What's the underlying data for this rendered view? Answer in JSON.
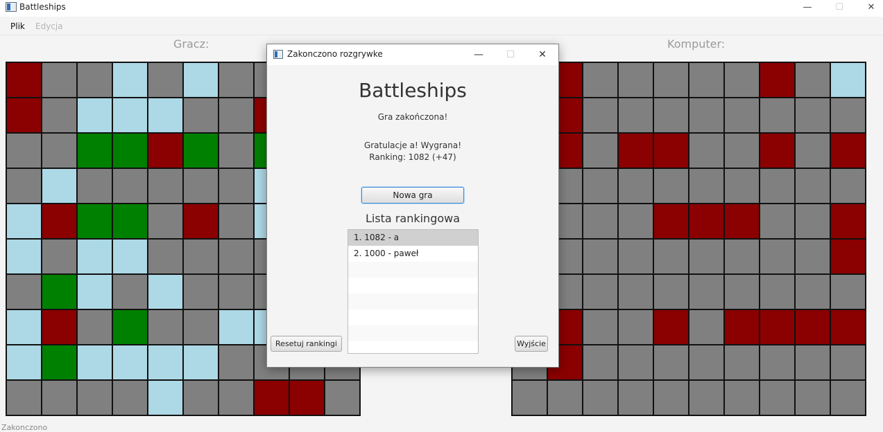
{
  "window": {
    "title": "Battleships",
    "minimize": "—",
    "maximize": "☐",
    "close": "✕"
  },
  "menu": [
    {
      "label": "Plik",
      "disabled": false
    },
    {
      "label": "Edycja",
      "disabled": true
    }
  ],
  "boards": {
    "player": {
      "label": "Gracz:",
      "rows": [
        "HGGWGWGGGG",
        "HGWWWGGHGG",
        "GGSSHSGSGG",
        "GWGGGGGWGG",
        "WHSSGHGWGG",
        "WGWWGGGGGG",
        "GSWGWGGGGG",
        "WHGSGGWWGG",
        "WSWWWWGGGG",
        "GGGGWGGHHG"
      ]
    },
    "computer": {
      "label": "Komputer:",
      "rows": [
        "GHGGGGGHGW",
        "GHGGGGGGGG",
        "GHGHHGGHGH",
        "GGGGGGGGGG",
        "GGGGHHHGGH",
        "GGGGGGGGGH",
        "GGGGGGGGGG",
        "GHGGHGHHHH",
        "GHGGGGGGGG",
        "GGGGGGGGGG"
      ]
    },
    "colors": {
      "G": "#808080",
      "H": "#8b0000",
      "W": "#add8e6",
      "S": "#008000"
    }
  },
  "status": "Zakonczono",
  "dialog": {
    "title": "Zakonczono rozgrywke",
    "heading": "Battleships",
    "game_over": "Gra zakończona!",
    "congrats": "Gratulacje a! Wygrana!",
    "ranking": "Ranking: 1082 (+47)",
    "new_game": "Nowa gra",
    "ranking_title": "Lista rankingowa",
    "ranking_list": [
      "1. 1082 - a",
      "2. 1000 - paweł"
    ],
    "selected_index": 0,
    "reset": "Resetuj rankingi",
    "exit": "Wyjście"
  }
}
